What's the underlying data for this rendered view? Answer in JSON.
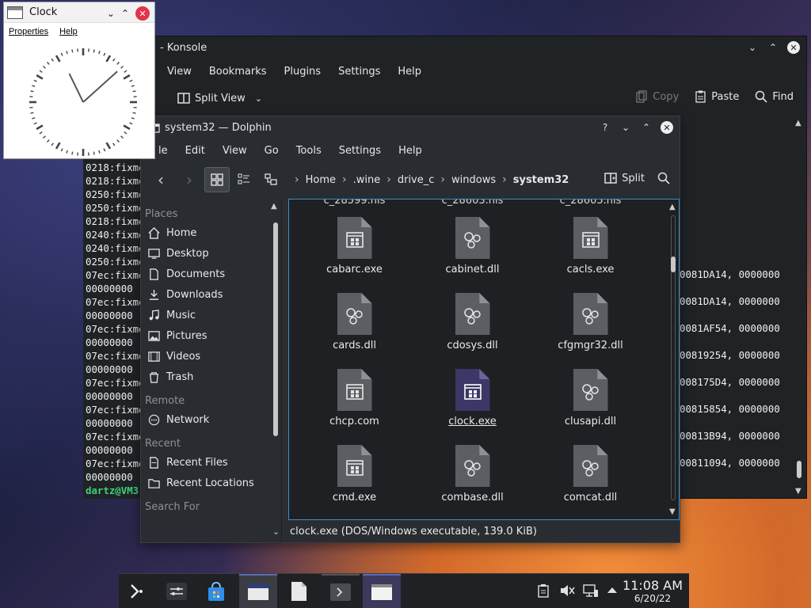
{
  "colors": {
    "selection": "#3d8ec9",
    "terminal_prompt": "#3fd17c",
    "clock_close": "#e0354a",
    "selected_icon": "#3c3766"
  },
  "clock": {
    "title": "Clock",
    "menu": [
      "Properties",
      "Help"
    ]
  },
  "konsole": {
    "title": "- Konsole",
    "menu": [
      "View",
      "Bookmarks",
      "Plugins",
      "Settings",
      "Help"
    ],
    "toolbar": {
      "split_view": "Split View",
      "copy": "Copy",
      "paste": "Paste",
      "find": "Find"
    },
    "left_lines": [
      "0218:fixme",
      "0218:fixme",
      "0250:fixme",
      "0250:fixme",
      "0218:fixme",
      "0240:fixme",
      "0240:fixme",
      "0250:fixme",
      "07ec:fixme",
      "00000000",
      "07ec:fixme",
      "00000000",
      "07ec:fixme",
      "00000000",
      "07ec:fixme",
      "00000000",
      "07ec:fixme",
      "00000000",
      "07ec:fixme",
      "00000000",
      "07ec:fixme",
      "00000000",
      "07ec:fixme",
      "00000000"
    ],
    "prompt": "dartz@VM3",
    "right_lines": [
      "0081DA14, 0000000",
      "0081DA14, 0000000",
      "0081AF54, 0000000",
      "00819254, 0000000",
      "008175D4, 0000000",
      "00815854, 0000000",
      "00813B94, 0000000",
      "00811094, 0000000"
    ]
  },
  "dolphin": {
    "title": "system32 — Dolphin",
    "menu": [
      "le",
      "Edit",
      "View",
      "Go",
      "Tools",
      "Settings",
      "Help"
    ],
    "breadcrumb": [
      "Home",
      ".wine",
      "drive_c",
      "windows",
      "system32"
    ],
    "split_label": "Split",
    "places": {
      "title": "Places",
      "items": [
        {
          "label": "Home",
          "icon": "home-icon"
        },
        {
          "label": "Desktop",
          "icon": "desktop-icon"
        },
        {
          "label": "Documents",
          "icon": "documents-icon"
        },
        {
          "label": "Downloads",
          "icon": "downloads-icon"
        },
        {
          "label": "Music",
          "icon": "music-icon"
        },
        {
          "label": "Pictures",
          "icon": "pictures-icon"
        },
        {
          "label": "Videos",
          "icon": "videos-icon"
        },
        {
          "label": "Trash",
          "icon": "trash-icon"
        }
      ],
      "remote_title": "Remote",
      "remote_items": [
        {
          "label": "Network",
          "icon": "network-icon"
        }
      ],
      "recent_title": "Recent",
      "recent_items": [
        {
          "label": "Recent Files",
          "icon": "recent-files-icon"
        },
        {
          "label": "Recent Locations",
          "icon": "recent-locations-icon"
        }
      ],
      "search_title": "Search For"
    },
    "cut_labels": [
      "c_28599.nls",
      "c_28603.nls",
      "c_28605.nls"
    ],
    "files": [
      {
        "name": "cabarc.exe",
        "type": "exe"
      },
      {
        "name": "cabinet.dll",
        "type": "dll"
      },
      {
        "name": "cacls.exe",
        "type": "exe"
      },
      {
        "name": "cards.dll",
        "type": "dll"
      },
      {
        "name": "cdosys.dll",
        "type": "dll"
      },
      {
        "name": "cfgmgr32.dll",
        "type": "dll"
      },
      {
        "name": "chcp.com",
        "type": "exe"
      },
      {
        "name": "clock.exe",
        "type": "exe",
        "selected": true
      },
      {
        "name": "clusapi.dll",
        "type": "dll"
      },
      {
        "name": "cmd.exe",
        "type": "exe"
      },
      {
        "name": "combase.dll",
        "type": "dll"
      },
      {
        "name": "comcat.dll",
        "type": "dll"
      }
    ],
    "status": "clock.exe (DOS/Windows executable, 139.0 KiB)"
  },
  "taskbar": {
    "time": "11:08 AM",
    "date": "6/20/22"
  }
}
